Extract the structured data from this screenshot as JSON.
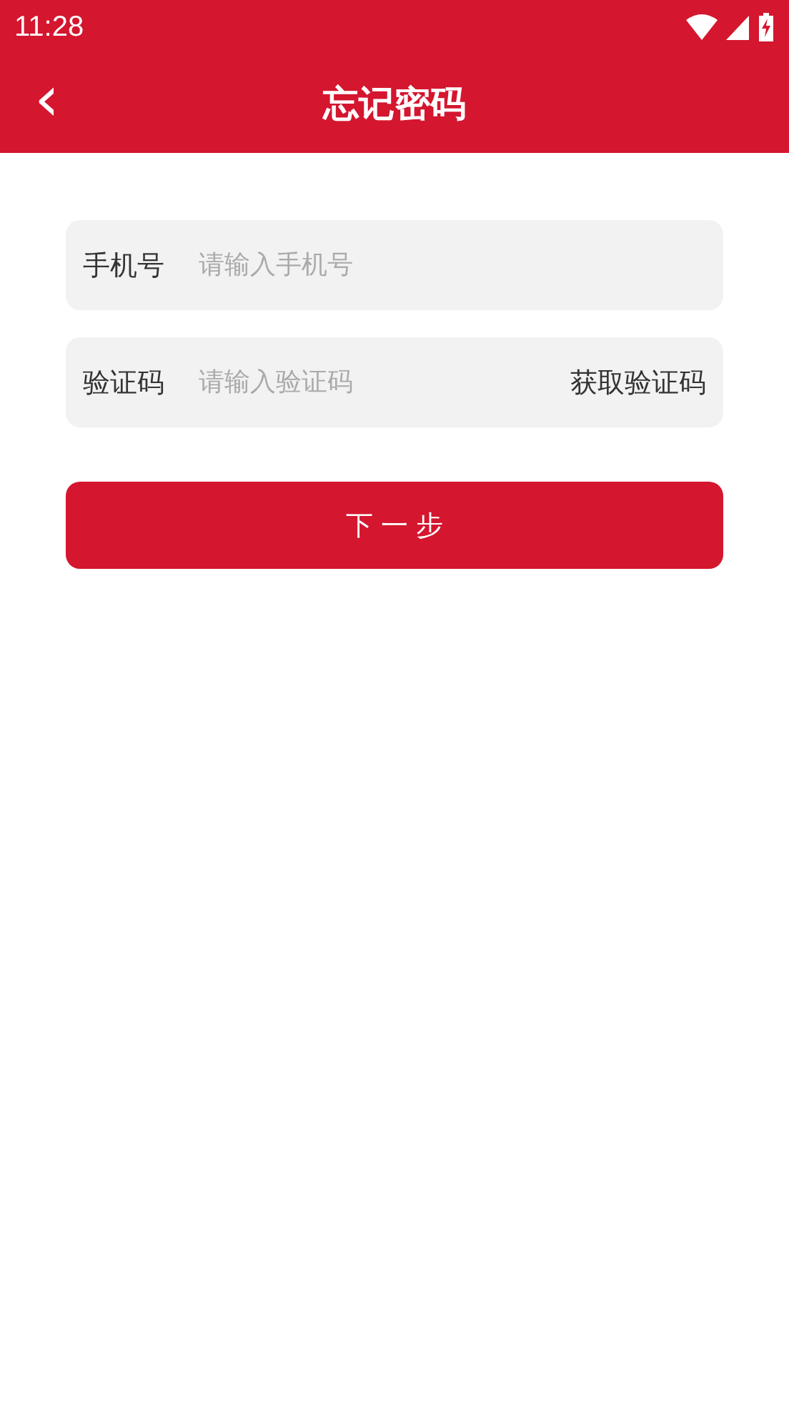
{
  "status_bar": {
    "time": "11:28"
  },
  "header": {
    "back_icon": "‹",
    "title": "忘记密码"
  },
  "fields": [
    {
      "label": "手机号",
      "placeholder": "请输入手机号"
    },
    {
      "label": "验证码",
      "placeholder": "请输入验证码",
      "action": "获取验证码"
    }
  ],
  "submit_button": "下 一 步"
}
